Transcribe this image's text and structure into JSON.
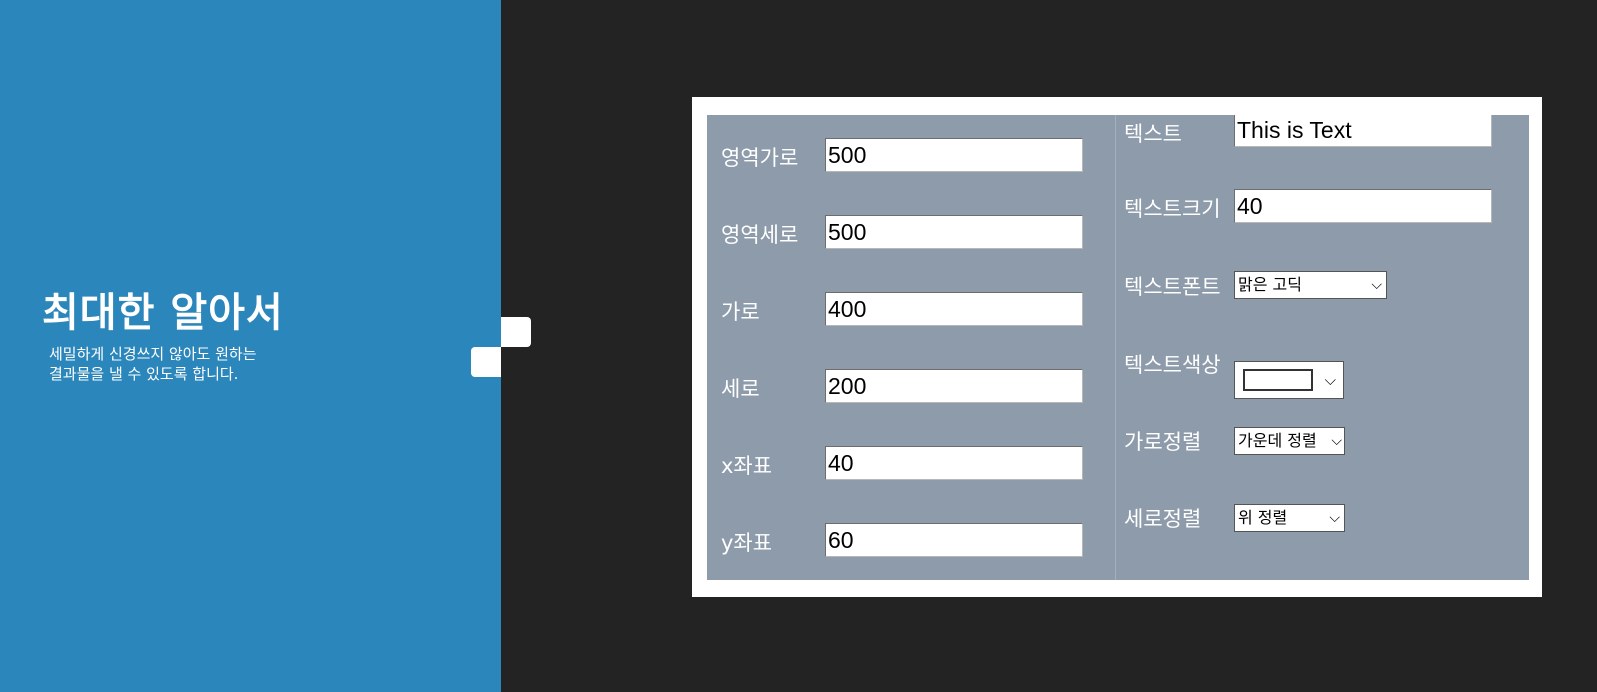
{
  "hero": {
    "title": "최대한 알아서",
    "desc_line1": "세밀하게 신경쓰지 않아도 원하는",
    "desc_line2": "결과물을 낼 수 있도록 합니다."
  },
  "form": {
    "left": [
      {
        "label": "영역가로",
        "value": "500"
      },
      {
        "label": "영역세로",
        "value": "500"
      },
      {
        "label": "가로",
        "value": "400"
      },
      {
        "label": "세로",
        "value": "200"
      },
      {
        "label": "x좌표",
        "value": "40"
      },
      {
        "label": "y좌표",
        "value": "60"
      }
    ],
    "right": {
      "text": {
        "label": "텍스트",
        "value": "This is Text"
      },
      "text_size": {
        "label": "텍스트크기",
        "value": "40"
      },
      "text_font": {
        "label": "텍스트폰트",
        "value": "맑은 고딕"
      },
      "text_color": {
        "label": "텍스트색상",
        "value": "#ffffff"
      },
      "h_align": {
        "label": "가로정렬",
        "value": "가운데 정렬"
      },
      "v_align": {
        "label": "세로정렬",
        "value": "위 정렬"
      }
    }
  },
  "icons": {
    "dropdown": "chevron-down-icon"
  },
  "colors": {
    "panel": "#2b86bb",
    "background": "#232323",
    "form_bg": "#8e9bab"
  }
}
